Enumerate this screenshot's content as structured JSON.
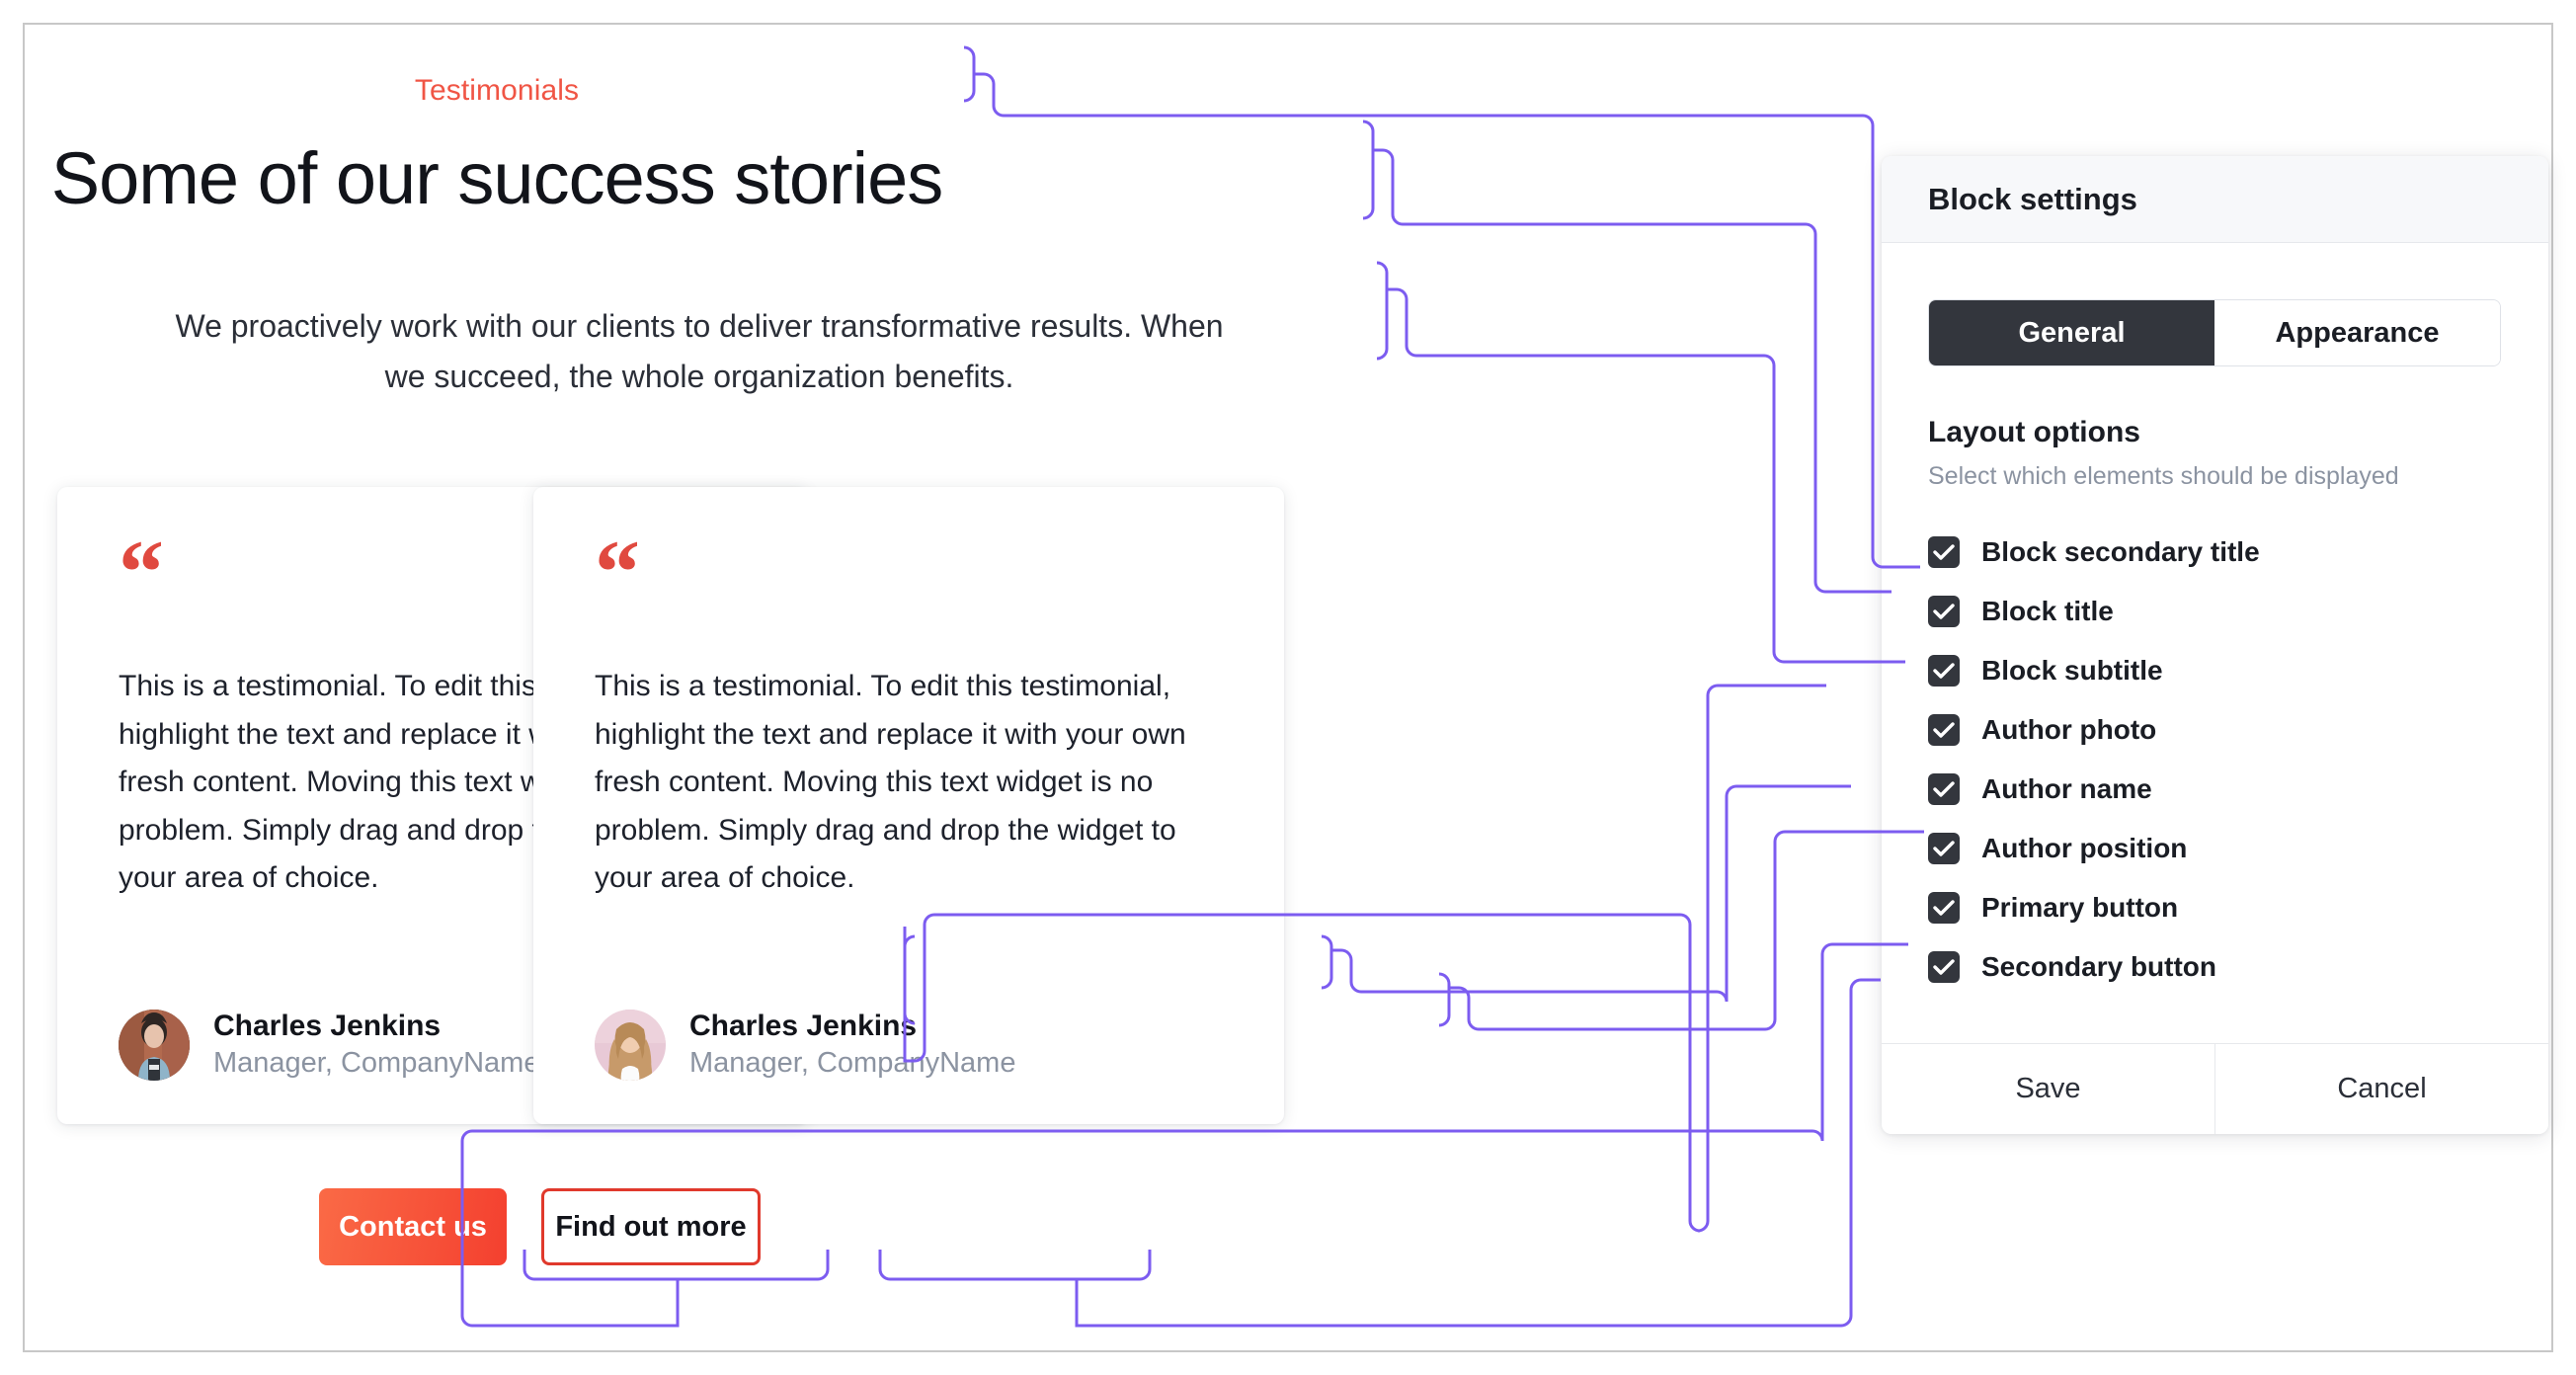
{
  "preview": {
    "eyebrow": "Testimonials",
    "title": "Some of our success stories",
    "subtitle": "We proactively work with our clients to deliver transformative results. When we succeed, the whole organization benefits.",
    "quote_glyph": "“",
    "cards": [
      {
        "body": "This is a testimonial. To edit this testimonial, highlight the text and replace it with your own fresh content. Moving this text widget is no problem. Simply drag and drop the widget to your area of choice.",
        "author_name": "Charles Jenkins",
        "author_position": "Manager, CompanyName",
        "avatar_alt": "author-photo-rust-background"
      },
      {
        "body": "This is a testimonial. To edit this testimonial, highlight the text and replace it with your own fresh content. Moving this text widget is no problem. Simply drag and drop the widget to your area of choice.",
        "author_name": "Charles Jenkins",
        "author_position": "Manager, CompanyName",
        "avatar_alt": "author-photo-pink-background"
      }
    ],
    "primary_button": "Contact us",
    "secondary_button": "Find out more"
  },
  "panel": {
    "header": "Block settings",
    "tabs": [
      {
        "label": "General",
        "active": true
      },
      {
        "label": "Appearance",
        "active": false
      }
    ],
    "layout_options_title": "Layout options",
    "layout_options_subtitle": "Select which elements should be displayed",
    "options": [
      {
        "label": "Block secondary title",
        "checked": true
      },
      {
        "label": "Block title",
        "checked": true
      },
      {
        "label": "Block subtitle",
        "checked": true
      },
      {
        "label": "Author photo",
        "checked": true
      },
      {
        "label": "Author name",
        "checked": true
      },
      {
        "label": "Author position",
        "checked": true
      },
      {
        "label": "Primary button",
        "checked": true
      },
      {
        "label": "Secondary button",
        "checked": true
      }
    ],
    "footer": {
      "save": "Save",
      "cancel": "Cancel"
    }
  },
  "colors": {
    "accent_red": "#f05545",
    "quote_red": "#e0493f",
    "button_gradient_start": "#fa6a46",
    "button_gradient_end": "#f4402f",
    "secondary_button_border": "#e0392c",
    "connector_purple": "#7c5cf0",
    "dark": "#33363d",
    "muted_text": "#8b93a1",
    "panel_header_bg": "#f7f8fa",
    "page_border": "#c8c8c8"
  }
}
